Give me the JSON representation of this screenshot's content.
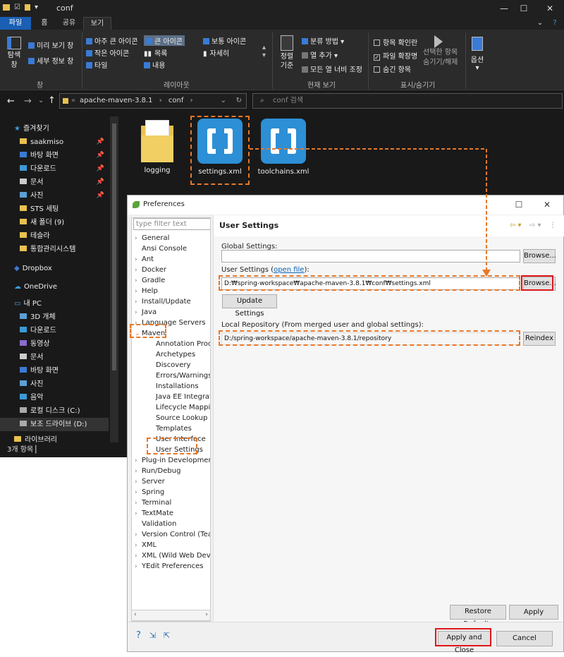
{
  "explorer": {
    "title": "conf",
    "tabs": [
      "파일",
      "홈",
      "공유",
      "보기"
    ],
    "ribbon": {
      "pane_nav": "탐색 창",
      "preview": "미리 보기 창",
      "details_pane": "세부 정보 창",
      "group_window": "창",
      "layouts": [
        "아주 큰 아이콘",
        "큰 아이콘",
        "보통 아이콘",
        "작은 아이콘",
        "목록",
        "자세히",
        "타일",
        "내용"
      ],
      "group_layout": "레이아웃",
      "sort": "정렬 기준",
      "group_by": "분류 방법",
      "add_column": "열 추가",
      "fit_columns": "모든 열 너비 조정",
      "group_current": "현재 보기",
      "item_checkbox": "항목 확인란",
      "file_ext": "파일 확장명",
      "hidden_items": "숨긴 항목",
      "hide_selected": "선택한 항목 숨기기/해제",
      "group_showhide": "표시/숨기기",
      "options": "옵션"
    },
    "address": {
      "crumbs": [
        "apache-maven-3.8.1",
        "conf"
      ],
      "search_placeholder": "conf 검색"
    },
    "nav": {
      "quick_access": "즐겨찾기",
      "pinned": [
        "saakmiso",
        "바탕 화면",
        "다운로드",
        "문서",
        "사진"
      ],
      "folders": [
        "STS 세팅",
        "새 폴더 (9)",
        "테슬라",
        "통합관리시스템"
      ],
      "dropbox": "Dropbox",
      "onedrive": "OneDrive",
      "pc": "내 PC",
      "pc_items": [
        "3D 개체",
        "다운로드",
        "동영상",
        "문서",
        "바탕 화면",
        "사진",
        "음악",
        "로컬 디스크 (C:)",
        "보조 드라이브 (D:)",
        "라이브러리"
      ]
    },
    "files": [
      "logging",
      "settings.xml",
      "toolchains.xml"
    ],
    "status": "3개 항목"
  },
  "prefs": {
    "title": "Preferences",
    "filter_placeholder": "type filter text",
    "tree_top": [
      "General",
      "Ansi Console",
      "Ant",
      "Docker",
      "Gradle",
      "Help",
      "Install/Update",
      "Java",
      "Language Servers"
    ],
    "maven": "Maven",
    "maven_children": [
      "Annotation Proce",
      "Archetypes",
      "Discovery",
      "Errors/Warnings",
      "Installations",
      "Java EE Integratio",
      "Lifecycle Mapping",
      "Source Lookup",
      "Templates",
      "User Interface",
      "User Settings"
    ],
    "tree_bottom": [
      "Plug-in Developmen",
      "Run/Debug",
      "Server",
      "Spring",
      "Terminal",
      "TextMate",
      "Validation",
      "Version Control (Tea",
      "XML",
      "XML (Wild Web Deve",
      "YEdit Preferences"
    ],
    "panel_title": "User Settings",
    "global_label": "Global Settings:",
    "global_value": "",
    "browse": "Browse...",
    "user_label": "User Settings (",
    "open_file": "open file",
    "user_label_end": "):",
    "user_value": "D:₩spring-workspace₩apache-maven-3.8.1₩conf₩settings.xml",
    "update": "Update Settings",
    "local_label": "Local Repository (From merged user and global settings):",
    "local_value": "D:/spring-workspace/apache-maven-3.8.1/repository",
    "reindex": "Reindex",
    "restore": "Restore Defaults",
    "apply": "Apply",
    "apply_close": "Apply and Close",
    "cancel": "Cancel"
  },
  "colors": {
    "highlight_dashed": "#e8782a",
    "highlight_solid": "#e0161a",
    "accent": "#1a5fb4"
  }
}
